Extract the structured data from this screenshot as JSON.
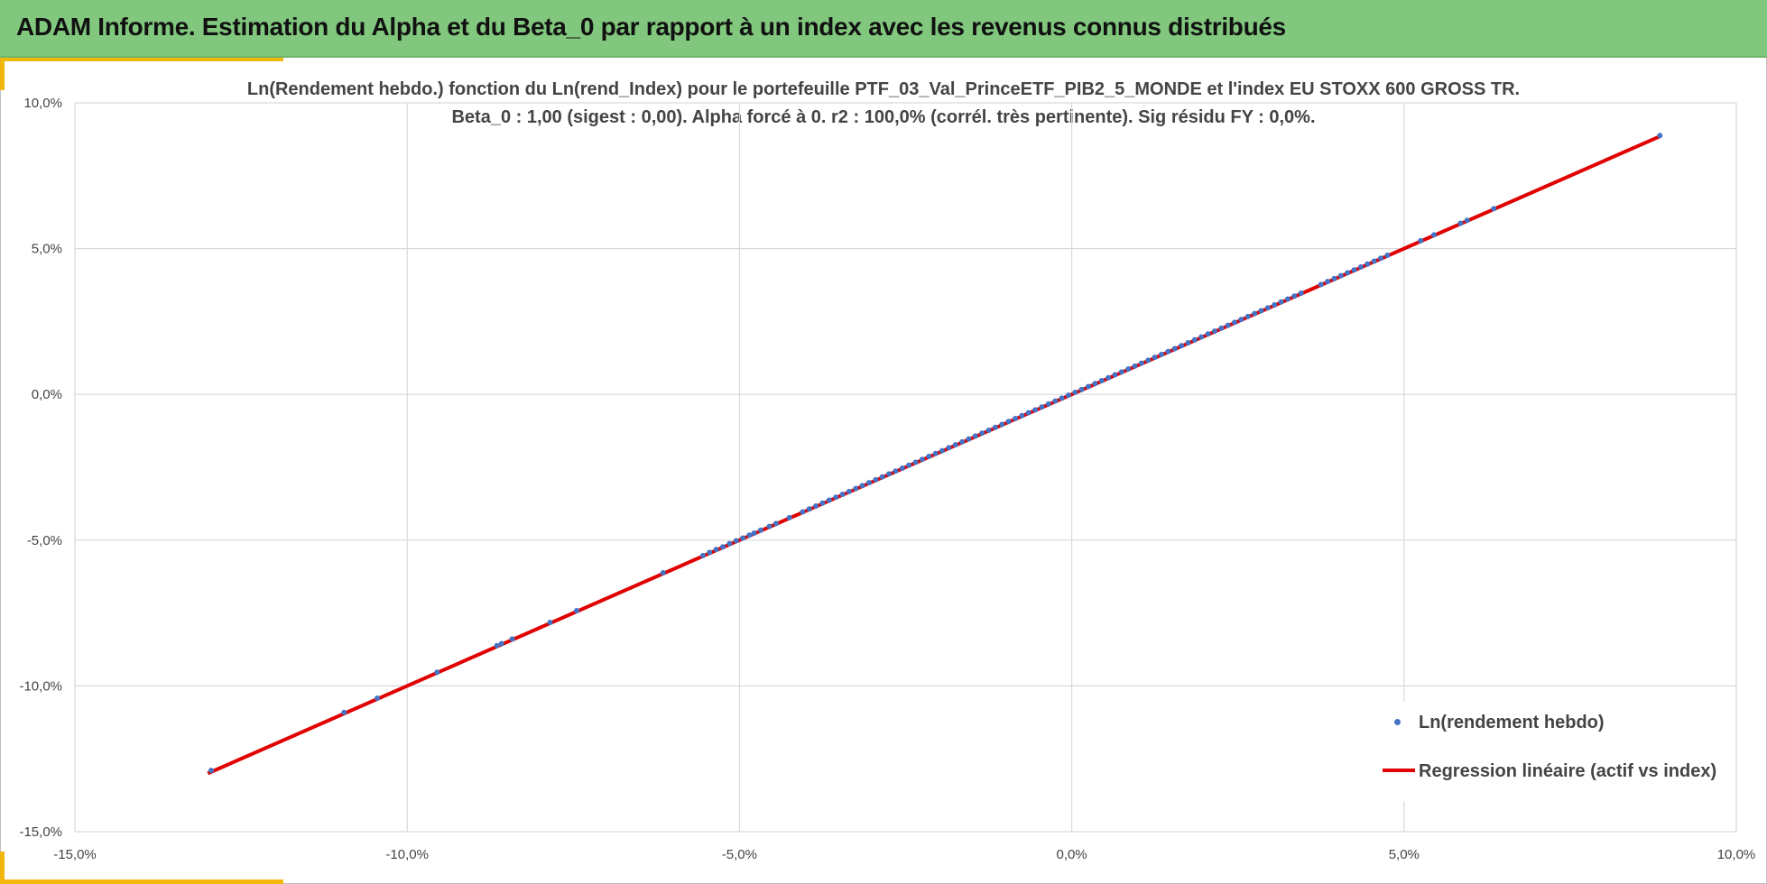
{
  "header": {
    "title": "ADAM Informe. Estimation du Alpha et du Beta_0 par rapport à un index avec les revenus connus distribués"
  },
  "colors": {
    "header_bg": "#81c77d",
    "accent": "#f2b70f",
    "points": "#4472c4",
    "regression": "#e00000",
    "grid": "#d9d9d9"
  },
  "chart_data": {
    "type": "scatter",
    "title": "Ln(Rendement hebdo.) fonction du Ln(rend_Index) pour le portefeuille PTF_03_Val_PrinceETF_PIB2_5_MONDE et l'index EU STOXX 600 GROSS TR.",
    "subtitle": "Beta_0 : 1,00 (sigest : 0,00).  Alpha forcé à 0. r2 : 100,0% (corrél. très pertinente). Sig résidu FY : 0,0%.",
    "xlabel": "",
    "ylabel": "",
    "xlim": [
      -0.15,
      0.1
    ],
    "ylim": [
      -0.15,
      0.1
    ],
    "x_ticks": [
      -0.15,
      -0.1,
      -0.05,
      0.0,
      0.05,
      0.1
    ],
    "y_ticks": [
      -0.15,
      -0.1,
      -0.05,
      0.0,
      0.05,
      0.1
    ],
    "x_tick_labels": [
      "-15,0%",
      "-10,0%",
      "-5,0%",
      "0,0%",
      "5,0%",
      "10,0%"
    ],
    "y_tick_labels": [
      "-15,0%",
      "-10,0%",
      "-5,0%",
      "0,0%",
      "5,0%",
      "10,0%"
    ],
    "grid": true,
    "legend_position": "bottom-right",
    "series": [
      {
        "name": "Ln(rendement hebdo)",
        "kind": "points",
        "x": [
          -0.1295,
          -0.1095,
          -0.1045,
          -0.0955,
          -0.0865,
          -0.0858,
          -0.0842,
          -0.0785,
          -0.0745,
          -0.0615,
          -0.0555,
          -0.0545,
          -0.0535,
          -0.0525,
          -0.0515,
          -0.0505,
          -0.0495,
          -0.0485,
          -0.0478,
          -0.0468,
          -0.0455,
          -0.0445,
          -0.0425,
          -0.0405,
          -0.0395,
          -0.0385,
          -0.0375,
          -0.0365,
          -0.0355,
          -0.0345,
          -0.0335,
          -0.0325,
          -0.0315,
          -0.0305,
          -0.0295,
          -0.0285,
          -0.0275,
          -0.0265,
          -0.0255,
          -0.0245,
          -0.0235,
          -0.0225,
          -0.0215,
          -0.0205,
          -0.0195,
          -0.0185,
          -0.0175,
          -0.0165,
          -0.0155,
          -0.0145,
          -0.0135,
          -0.0125,
          -0.0115,
          -0.0105,
          -0.0095,
          -0.0085,
          -0.0075,
          -0.0065,
          -0.0055,
          -0.0045,
          -0.0035,
          -0.0025,
          -0.0015,
          -0.0005,
          0.0005,
          0.0015,
          0.0025,
          0.0035,
          0.0045,
          0.0055,
          0.0065,
          0.0075,
          0.0085,
          0.0095,
          0.0105,
          0.0115,
          0.0125,
          0.0135,
          0.0145,
          0.0155,
          0.0165,
          0.0175,
          0.0185,
          0.0195,
          0.0205,
          0.0215,
          0.0225,
          0.0235,
          0.0245,
          0.0255,
          0.0265,
          0.0275,
          0.0285,
          0.0295,
          0.0305,
          0.0315,
          0.0325,
          0.0335,
          0.0345,
          0.0375,
          0.0385,
          0.0395,
          0.0405,
          0.0415,
          0.0425,
          0.0435,
          0.0445,
          0.0455,
          0.0465,
          0.0475,
          0.0525,
          0.0545,
          0.0585,
          0.0595,
          0.0635,
          0.0885
        ],
        "y": [
          -0.129,
          -0.1091,
          -0.1042,
          -0.0953,
          -0.0862,
          -0.0855,
          -0.0839,
          -0.0782,
          -0.0742,
          -0.0612,
          -0.0553,
          -0.0542,
          -0.0532,
          -0.0523,
          -0.0512,
          -0.0502,
          -0.0493,
          -0.0483,
          -0.0476,
          -0.0466,
          -0.0453,
          -0.0443,
          -0.0423,
          -0.0403,
          -0.0393,
          -0.0383,
          -0.0373,
          -0.0363,
          -0.0353,
          -0.0343,
          -0.0333,
          -0.0323,
          -0.0313,
          -0.0303,
          -0.0293,
          -0.0283,
          -0.0273,
          -0.0263,
          -0.0253,
          -0.0243,
          -0.0233,
          -0.0223,
          -0.0213,
          -0.0203,
          -0.0193,
          -0.0183,
          -0.0173,
          -0.0163,
          -0.0153,
          -0.0143,
          -0.0133,
          -0.0123,
          -0.0113,
          -0.0103,
          -0.0093,
          -0.0083,
          -0.0073,
          -0.0063,
          -0.0053,
          -0.0043,
          -0.0033,
          -0.0023,
          -0.0013,
          -0.0003,
          0.0007,
          0.0017,
          0.0027,
          0.0037,
          0.0047,
          0.0057,
          0.0067,
          0.0077,
          0.0087,
          0.0097,
          0.0107,
          0.0117,
          0.0127,
          0.0137,
          0.0147,
          0.0157,
          0.0167,
          0.0177,
          0.0187,
          0.0197,
          0.0207,
          0.0217,
          0.0227,
          0.0237,
          0.0247,
          0.0257,
          0.0267,
          0.0277,
          0.0287,
          0.0297,
          0.0307,
          0.0317,
          0.0327,
          0.0337,
          0.0347,
          0.0377,
          0.0387,
          0.0397,
          0.0407,
          0.0417,
          0.0427,
          0.0437,
          0.0447,
          0.0457,
          0.0467,
          0.0477,
          0.0527,
          0.0547,
          0.0587,
          0.0597,
          0.0637,
          0.0888
        ]
      },
      {
        "name": "Regression linéaire (actif vs index)",
        "kind": "line",
        "x": [
          -0.13,
          0.0885
        ],
        "y": [
          -0.13,
          0.0885
        ]
      }
    ]
  }
}
